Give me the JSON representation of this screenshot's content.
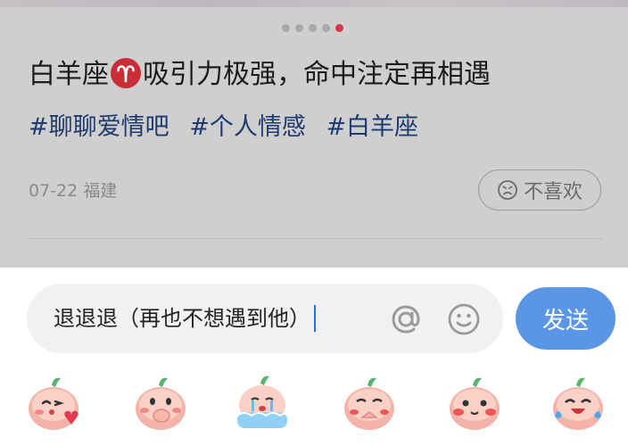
{
  "post": {
    "pager": {
      "total": 5,
      "active_index": 4
    },
    "title_before_icon": "白羊座",
    "title_after_icon": "吸引力极强，命中注定再相遇",
    "title_icon": "aries-icon",
    "tags": [
      "#聊聊爱情吧",
      "#个人情感",
      "#白羊座"
    ],
    "date": "07-22",
    "location": "福建",
    "dislike_label": "不喜欢"
  },
  "composer": {
    "input_value": "退退退（再也不想遇到他）",
    "send_label": "发送",
    "at_icon": "at-icon",
    "emoji_icon": "smiley-icon"
  },
  "stickers": [
    {
      "name": "sticker-kiss-heart"
    },
    {
      "name": "sticker-cover-mouth"
    },
    {
      "name": "sticker-crying-in-water"
    },
    {
      "name": "sticker-pleading"
    },
    {
      "name": "sticker-blushing"
    },
    {
      "name": "sticker-laugh-cry"
    }
  ],
  "colors": {
    "accent_red": "#d8394a",
    "tag_blue": "#1f3a70",
    "send_blue": "#5b95e6",
    "caret_blue": "#2f6fdc"
  }
}
